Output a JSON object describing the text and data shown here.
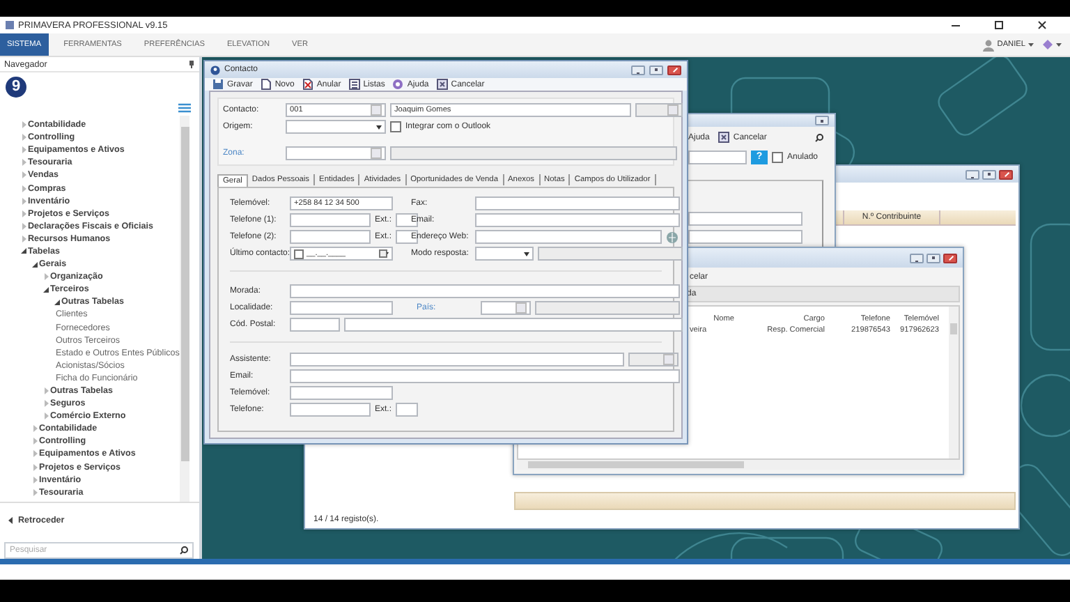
{
  "app": {
    "title": "PRIMAVERA PROFESSIONAL v9.15"
  },
  "menu": [
    {
      "label": "SISTEMA",
      "selected": true
    },
    {
      "label": "FERRAMENTAS",
      "selected": false
    },
    {
      "label": "PREFERÊNCIAS",
      "selected": false
    },
    {
      "label": "ELEVATION",
      "selected": false
    },
    {
      "label": "VER",
      "selected": false
    }
  ],
  "user": {
    "name": "DANIEL"
  },
  "navigator": {
    "title": "Navegador",
    "logo": "9",
    "back": "Retroceder",
    "search_placeholder": "Pesquisar",
    "tree": [
      {
        "label": "Contabilidade",
        "kind": "folder",
        "expanded": false
      },
      {
        "label": "Controlling",
        "kind": "folder",
        "expanded": false
      },
      {
        "label": "Equipamentos e Ativos",
        "kind": "folder",
        "expanded": false
      },
      {
        "label": "Tesouraria",
        "kind": "folder",
        "expanded": false
      },
      {
        "label": "Vendas",
        "kind": "folder",
        "expanded": false
      },
      {
        "label": "Compras",
        "kind": "folder",
        "expanded": false
      },
      {
        "label": "Inventário",
        "kind": "folder",
        "expanded": false
      },
      {
        "label": "Projetos e Serviços",
        "kind": "folder",
        "expanded": false
      },
      {
        "label": "Declarações Fiscais e Oficiais",
        "kind": "folder",
        "expanded": false
      },
      {
        "label": "Recursos Humanos",
        "kind": "folder",
        "expanded": false
      },
      {
        "label": "Tabelas",
        "kind": "folder",
        "expanded": true,
        "children": [
          {
            "label": "Gerais",
            "kind": "folder",
            "expanded": true,
            "children": [
              {
                "label": "Organização",
                "kind": "folder",
                "expanded": false
              },
              {
                "label": "Terceiros",
                "kind": "folder",
                "expanded": true,
                "children": [
                  {
                    "label": "Outras Tabelas",
                    "kind": "folder",
                    "expanded": true,
                    "children": [
                      {
                        "label": "Clientes",
                        "kind": "leaf"
                      },
                      {
                        "label": "Fornecedores",
                        "kind": "leaf"
                      },
                      {
                        "label": "Outros Terceiros",
                        "kind": "leaf"
                      },
                      {
                        "label": "Estado e Outros Entes Públicos",
                        "kind": "leaf"
                      },
                      {
                        "label": "Acionistas/Sócios",
                        "kind": "leaf"
                      },
                      {
                        "label": "Ficha do Funcionário",
                        "kind": "leaf"
                      }
                    ]
                  }
                ]
              },
              {
                "label": "Outras Tabelas",
                "kind": "folder",
                "expanded": false
              },
              {
                "label": "Seguros",
                "kind": "folder",
                "expanded": false
              },
              {
                "label": "Comércio Externo",
                "kind": "folder",
                "expanded": false
              }
            ]
          },
          {
            "label": "Contabilidade",
            "kind": "folder",
            "expanded": false
          },
          {
            "label": "Controlling",
            "kind": "folder",
            "expanded": false
          },
          {
            "label": "Equipamentos e Ativos",
            "kind": "folder",
            "expanded": false
          },
          {
            "label": "Projetos e Serviços",
            "kind": "folder",
            "expanded": false
          },
          {
            "label": "Inventário",
            "kind": "folder",
            "expanded": false
          },
          {
            "label": "Tesouraria",
            "kind": "folder",
            "expanded": false
          }
        ]
      }
    ]
  },
  "contact_dialog": {
    "title": "Contacto",
    "toolbar": [
      {
        "label": "Gravar",
        "kind": "save"
      },
      {
        "label": "Novo",
        "kind": "new"
      },
      {
        "label": "Anular",
        "kind": "void"
      },
      {
        "label": "Listas",
        "kind": "list"
      },
      {
        "label": "Ajuda",
        "kind": "help"
      },
      {
        "label": "Cancelar",
        "kind": "cancel"
      }
    ],
    "contact": {
      "label": "Contacto:",
      "code": "001",
      "name": "Joaquim Gomes"
    },
    "origin": {
      "label": "Origem:"
    },
    "outlook": {
      "label": "Integrar com o Outlook",
      "checked": false
    },
    "zone": {
      "label": "Zona:"
    },
    "tabs": [
      {
        "label": "Geral",
        "selected": true
      },
      {
        "label": "Dados Pessoais",
        "selected": false
      },
      {
        "label": "Entidades",
        "selected": false
      },
      {
        "label": "Atividades",
        "selected": false
      },
      {
        "label": "Oportunidades de Venda",
        "selected": false
      },
      {
        "label": "Anexos",
        "selected": false
      },
      {
        "label": "Notas",
        "selected": false
      },
      {
        "label": "Campos do Utilizador",
        "selected": false
      }
    ],
    "phones": [
      {
        "label": "Telemóvel:",
        "kind": "text",
        "value": "+258 84 12 34 500"
      },
      {
        "label": "Telefone (1):",
        "kind": "phone",
        "ext": "Ext.:"
      },
      {
        "label": "Telefone (2):",
        "kind": "phone",
        "ext": "Ext.:"
      },
      {
        "label": "Último contacto:",
        "kind": "date",
        "value": "__.__.____"
      }
    ],
    "contact_info": [
      {
        "label": "Fax:",
        "kind": "text"
      },
      {
        "label": "Email:",
        "kind": "text"
      },
      {
        "label": "Endereço Web:",
        "kind": "web"
      },
      {
        "label": "Modo resposta:",
        "kind": "dropdown"
      }
    ],
    "address": [
      {
        "label": "Morada:",
        "kind": "wide"
      },
      {
        "label": "Localidade:",
        "kind": "city",
        "extra": "País:"
      },
      {
        "label": "Cód. Postal:",
        "kind": "postal"
      }
    ],
    "assistant": [
      {
        "label": "Assistente:",
        "kind": "lookup"
      },
      {
        "label": "Email:",
        "kind": "wide"
      },
      {
        "label": "Telemóvel:",
        "kind": "short"
      },
      {
        "label": "Telefone:",
        "kind": "phone",
        "ext": "Ext.:"
      }
    ]
  },
  "back_window": {
    "toolbar": [
      "Ajuda",
      "Cancelar"
    ],
    "help_button": "?",
    "voided": {
      "label": "Anulado",
      "checked": false
    }
  },
  "list_window": {
    "column": "N.º Contribuinte",
    "status": "14 / 14 registo(s)."
  },
  "people_window": {
    "toolbar": "celar",
    "group": "da",
    "columns": [
      "Nome",
      "Cargo",
      "Telefone",
      "Telemóvel"
    ],
    "rows": [
      [
        "veira",
        "Resp. Comercial",
        "219876543",
        "917962623"
      ]
    ]
  }
}
